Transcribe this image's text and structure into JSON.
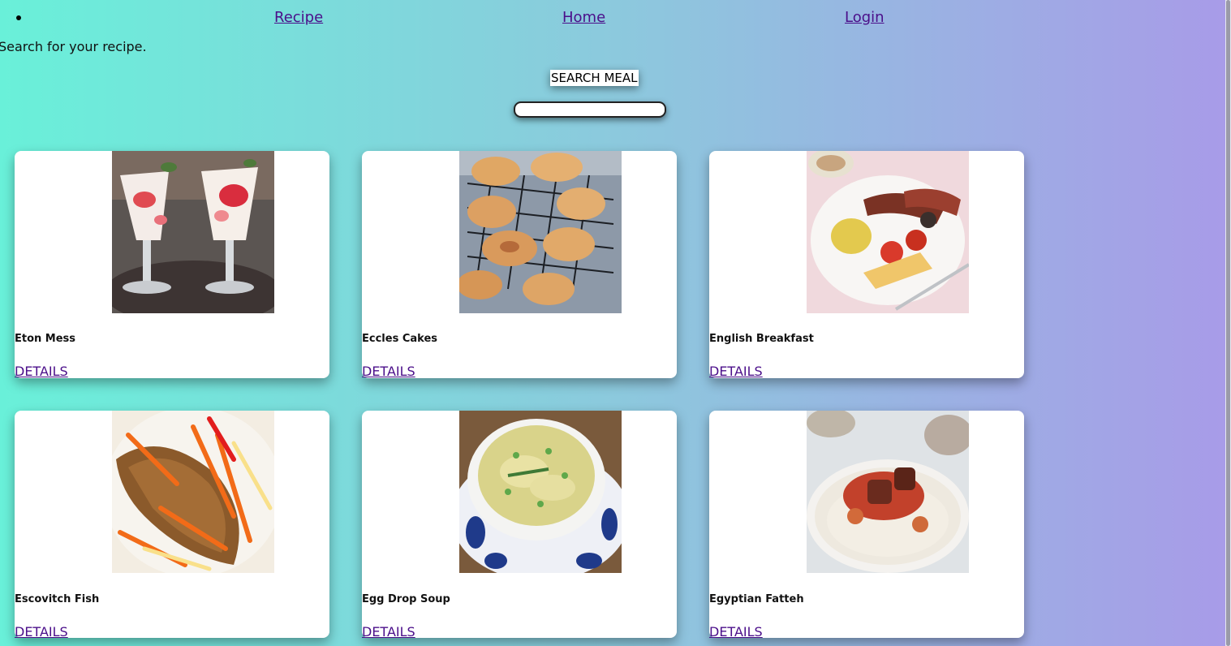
{
  "nav": {
    "items": [
      {
        "label": "Recipe"
      },
      {
        "label": "Home"
      },
      {
        "label": "Login"
      }
    ]
  },
  "subtitle": "Search for your recipe.",
  "search": {
    "button_label": "SEARCH MEAL",
    "value": "",
    "placeholder": ""
  },
  "meals": [
    {
      "name": "Eton Mess",
      "details_label": "DETAILS",
      "image": "eton-mess-photo"
    },
    {
      "name": "Eccles Cakes",
      "details_label": "DETAILS",
      "image": "eccles-cakes-photo"
    },
    {
      "name": "English Breakfast",
      "details_label": "DETAILS",
      "image": "english-breakfast-photo"
    },
    {
      "name": "Escovitch Fish",
      "details_label": "DETAILS",
      "image": "escovitch-fish-photo"
    },
    {
      "name": "Egg Drop Soup",
      "details_label": "DETAILS",
      "image": "egg-drop-soup-photo"
    },
    {
      "name": "Egyptian Fatteh",
      "details_label": "DETAILS",
      "image": "egyptian-fatteh-photo"
    }
  ],
  "colors": {
    "gradient_left": "#69f0d9",
    "gradient_right": "#a89be8",
    "link": "#4b0f8a"
  }
}
